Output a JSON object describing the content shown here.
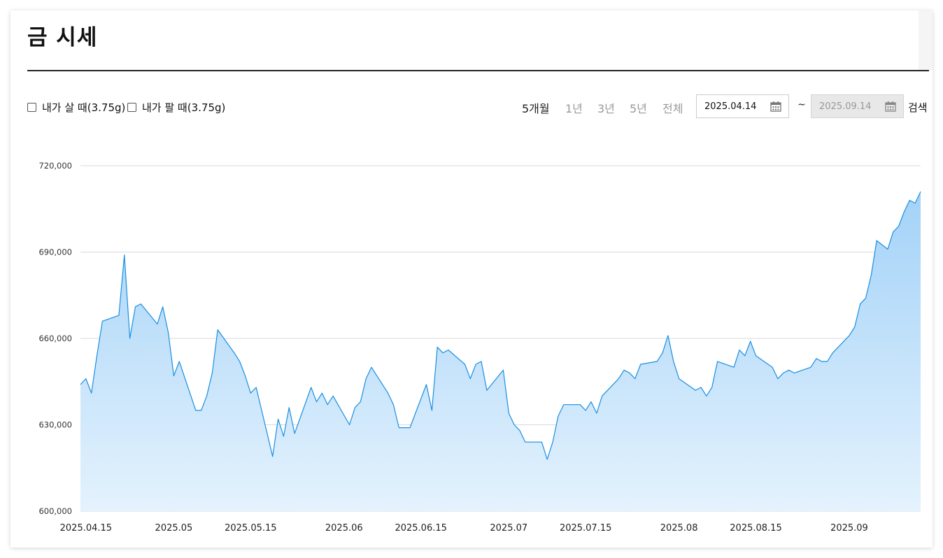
{
  "header": {
    "title": "금 시세"
  },
  "filters": {
    "buy_label": "내가 살 때(3.75g)",
    "sell_label": "내가 팔 때(3.75g)"
  },
  "periods": [
    "5개월",
    "1년",
    "3년",
    "5년",
    "전체"
  ],
  "active_period": "5개월",
  "date_range": {
    "start": "2025.04.14",
    "separator": "~",
    "end": "2025.09.14"
  },
  "search_label": "검색",
  "colors": {
    "line": "#1a8fe0",
    "fill_top": "#a3d2f8",
    "fill_bottom": "#e4f2fd",
    "grid": "#d8d8d8"
  },
  "chart_data": {
    "type": "area",
    "title": "",
    "xlabel": "",
    "ylabel": "",
    "ylim": [
      600000,
      720000
    ],
    "yticks": [
      "720,000",
      "690,000",
      "660,000",
      "630,000",
      "600,000"
    ],
    "yticks_values": [
      720000,
      690000,
      660000,
      630000,
      600000
    ],
    "xticks": [
      {
        "label": "2025.04.15",
        "date": "2025-04-15"
      },
      {
        "label": "2025.05",
        "date": "2025-05-01"
      },
      {
        "label": "2025.05.15",
        "date": "2025-05-15"
      },
      {
        "label": "2025.06",
        "date": "2025-06-01"
      },
      {
        "label": "2025.06.15",
        "date": "2025-06-15"
      },
      {
        "label": "2025.07",
        "date": "2025-07-01"
      },
      {
        "label": "2025.07.15",
        "date": "2025-07-15"
      },
      {
        "label": "2025.08",
        "date": "2025-08-01"
      },
      {
        "label": "2025.08.15",
        "date": "2025-08-15"
      },
      {
        "label": "2025.09",
        "date": "2025-09-01"
      }
    ],
    "grid": true,
    "legend": "none",
    "series": [
      {
        "points": [
          [
            "2025-04-14",
            644000
          ],
          [
            "2025-04-15",
            646000
          ],
          [
            "2025-04-16",
            641000
          ],
          [
            "2025-04-17",
            654000
          ],
          [
            "2025-04-18",
            666000
          ],
          [
            "2025-04-21",
            668000
          ],
          [
            "2025-04-22",
            689000
          ],
          [
            "2025-04-23",
            660000
          ],
          [
            "2025-04-24",
            671000
          ],
          [
            "2025-04-25",
            672000
          ],
          [
            "2025-04-28",
            665000
          ],
          [
            "2025-04-29",
            671000
          ],
          [
            "2025-04-30",
            662000
          ],
          [
            "2025-05-01",
            647000
          ],
          [
            "2025-05-02",
            652000
          ],
          [
            "2025-05-05",
            635000
          ],
          [
            "2025-05-06",
            635000
          ],
          [
            "2025-05-07",
            640000
          ],
          [
            "2025-05-08",
            648000
          ],
          [
            "2025-05-09",
            663000
          ],
          [
            "2025-05-12",
            655000
          ],
          [
            "2025-05-13",
            652000
          ],
          [
            "2025-05-14",
            647000
          ],
          [
            "2025-05-15",
            641000
          ],
          [
            "2025-05-16",
            643000
          ],
          [
            "2025-05-19",
            619000
          ],
          [
            "2025-05-20",
            632000
          ],
          [
            "2025-05-21",
            626000
          ],
          [
            "2025-05-22",
            636000
          ],
          [
            "2025-05-23",
            627000
          ],
          [
            "2025-05-26",
            643000
          ],
          [
            "2025-05-27",
            638000
          ],
          [
            "2025-05-28",
            641000
          ],
          [
            "2025-05-29",
            637000
          ],
          [
            "2025-05-30",
            640000
          ],
          [
            "2025-06-02",
            630000
          ],
          [
            "2025-06-03",
            636000
          ],
          [
            "2025-06-04",
            638000
          ],
          [
            "2025-06-05",
            646000
          ],
          [
            "2025-06-06",
            650000
          ],
          [
            "2025-06-09",
            641000
          ],
          [
            "2025-06-10",
            637000
          ],
          [
            "2025-06-11",
            629000
          ],
          [
            "2025-06-12",
            629000
          ],
          [
            "2025-06-13",
            629000
          ],
          [
            "2025-06-16",
            644000
          ],
          [
            "2025-06-17",
            635000
          ],
          [
            "2025-06-18",
            657000
          ],
          [
            "2025-06-19",
            655000
          ],
          [
            "2025-06-20",
            656000
          ],
          [
            "2025-06-23",
            651000
          ],
          [
            "2025-06-24",
            646000
          ],
          [
            "2025-06-25",
            651000
          ],
          [
            "2025-06-26",
            652000
          ],
          [
            "2025-06-27",
            642000
          ],
          [
            "2025-06-30",
            649000
          ],
          [
            "2025-07-01",
            634000
          ],
          [
            "2025-07-02",
            630000
          ],
          [
            "2025-07-03",
            628000
          ],
          [
            "2025-07-04",
            624000
          ],
          [
            "2025-07-07",
            624000
          ],
          [
            "2025-07-08",
            618000
          ],
          [
            "2025-07-09",
            624000
          ],
          [
            "2025-07-10",
            633000
          ],
          [
            "2025-07-11",
            637000
          ],
          [
            "2025-07-14",
            637000
          ],
          [
            "2025-07-15",
            635000
          ],
          [
            "2025-07-16",
            638000
          ],
          [
            "2025-07-17",
            634000
          ],
          [
            "2025-07-18",
            640000
          ],
          [
            "2025-07-21",
            646000
          ],
          [
            "2025-07-22",
            649000
          ],
          [
            "2025-07-23",
            648000
          ],
          [
            "2025-07-24",
            646000
          ],
          [
            "2025-07-25",
            651000
          ],
          [
            "2025-07-28",
            652000
          ],
          [
            "2025-07-29",
            655000
          ],
          [
            "2025-07-30",
            661000
          ],
          [
            "2025-07-31",
            652000
          ],
          [
            "2025-08-01",
            646000
          ],
          [
            "2025-08-04",
            642000
          ],
          [
            "2025-08-05",
            643000
          ],
          [
            "2025-08-06",
            640000
          ],
          [
            "2025-08-07",
            643000
          ],
          [
            "2025-08-08",
            652000
          ],
          [
            "2025-08-11",
            650000
          ],
          [
            "2025-08-12",
            656000
          ],
          [
            "2025-08-13",
            654000
          ],
          [
            "2025-08-14",
            659000
          ],
          [
            "2025-08-15",
            654000
          ],
          [
            "2025-08-18",
            650000
          ],
          [
            "2025-08-19",
            646000
          ],
          [
            "2025-08-20",
            648000
          ],
          [
            "2025-08-21",
            649000
          ],
          [
            "2025-08-22",
            648000
          ],
          [
            "2025-08-25",
            650000
          ],
          [
            "2025-08-26",
            653000
          ],
          [
            "2025-08-27",
            652000
          ],
          [
            "2025-08-28",
            652000
          ],
          [
            "2025-08-29",
            655000
          ],
          [
            "2025-09-01",
            661000
          ],
          [
            "2025-09-02",
            664000
          ],
          [
            "2025-09-03",
            672000
          ],
          [
            "2025-09-04",
            674000
          ],
          [
            "2025-09-05",
            682000
          ],
          [
            "2025-09-06",
            694000
          ],
          [
            "2025-09-08",
            691000
          ],
          [
            "2025-09-09",
            697000
          ],
          [
            "2025-09-10",
            699000
          ],
          [
            "2025-09-11",
            704000
          ],
          [
            "2025-09-12",
            708000
          ],
          [
            "2025-09-13",
            707000
          ],
          [
            "2025-09-14",
            711000
          ]
        ]
      }
    ]
  }
}
